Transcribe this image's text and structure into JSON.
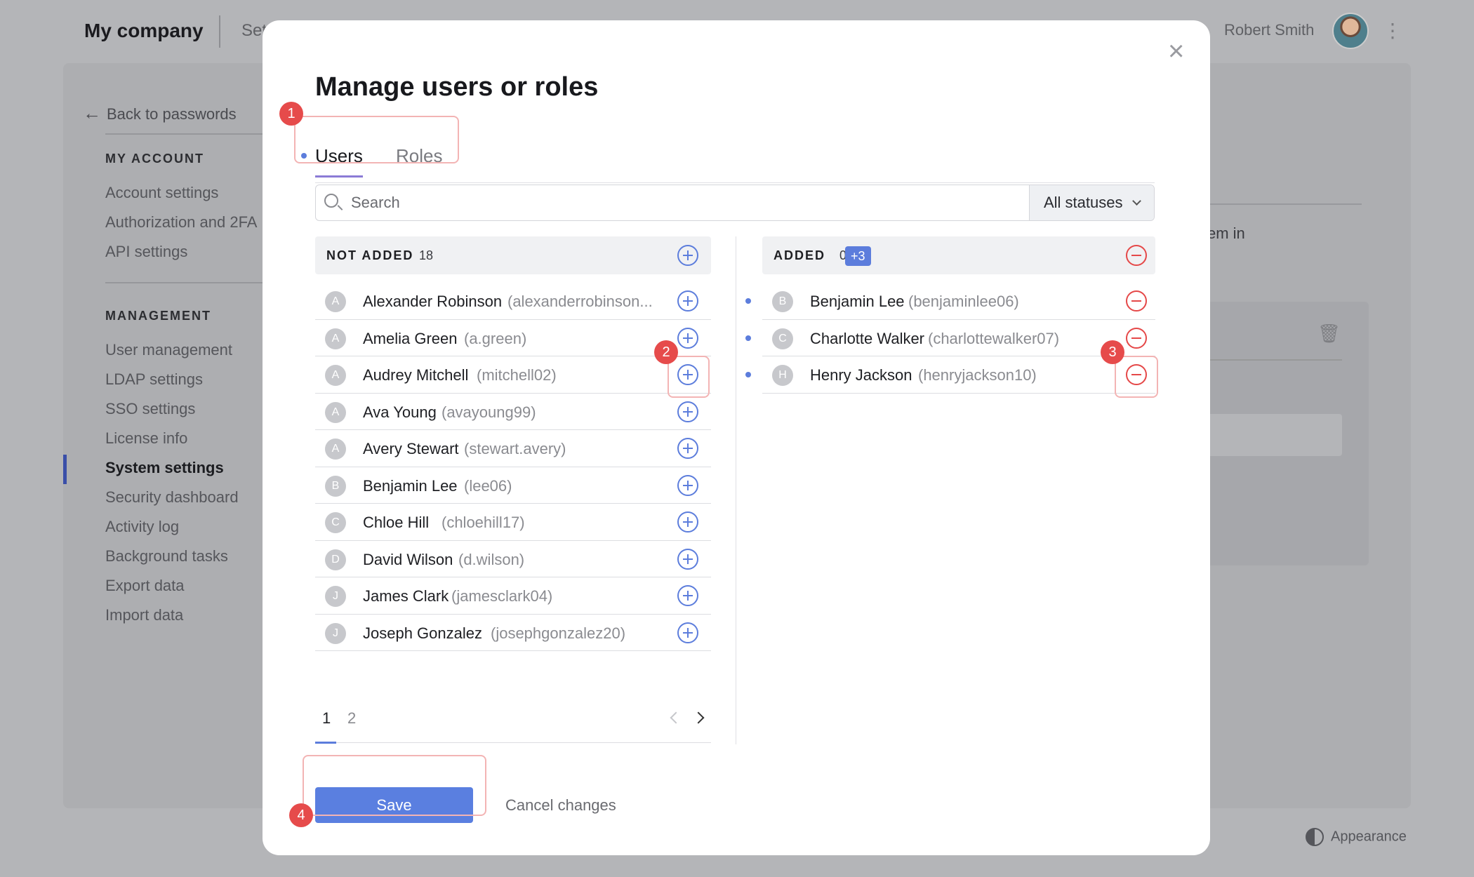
{
  "topbar": {
    "brand": "My company",
    "section": "Set",
    "user_name": "Robert Smith",
    "kebab": "⋮"
  },
  "sidebar": {
    "back_label": "Back to passwords",
    "my_account_heading": "MY ACCOUNT",
    "my_account_items": [
      "Account settings",
      "Authorization and 2FA",
      "API settings"
    ],
    "management_heading": "MANAGEMENT",
    "management_items": [
      {
        "label": "User management",
        "active": false
      },
      {
        "label": "LDAP settings",
        "active": false
      },
      {
        "label": "SSO settings",
        "active": false
      },
      {
        "label": "License info",
        "active": false
      },
      {
        "label": "System settings",
        "active": true
      },
      {
        "label": "Security dashboard",
        "active": false
      },
      {
        "label": "Activity log",
        "active": false
      },
      {
        "label": "Background tasks",
        "active": false
      },
      {
        "label": "Export data",
        "active": false
      },
      {
        "label": "Import data",
        "active": false
      }
    ]
  },
  "bg_right": {
    "partial_text": "em in"
  },
  "appearance_label": "Appearance",
  "modal": {
    "title": "Manage users or roles",
    "close_glyph": "×",
    "tabs": {
      "users": "Users",
      "roles": "Roles"
    },
    "search": {
      "placeholder": "Search"
    },
    "status_filter": "All statuses",
    "not_added": {
      "title": "NOT ADDED",
      "count": "18",
      "rows": [
        {
          "initial": "A",
          "name": "Alexander Robinson",
          "username": "(alexanderrobinson..."
        },
        {
          "initial": "A",
          "name": "Amelia Green",
          "username": "(a.green)"
        },
        {
          "initial": "A",
          "name": "Audrey Mitchell",
          "username": "(mitchell02)"
        },
        {
          "initial": "A",
          "name": "Ava Young",
          "username": "(avayoung99)"
        },
        {
          "initial": "A",
          "name": "Avery Stewart",
          "username": "(stewart.avery)"
        },
        {
          "initial": "B",
          "name": "Benjamin Lee",
          "username": "(lee06)"
        },
        {
          "initial": "C",
          "name": "Chloe Hill",
          "username": "(chloehill17)"
        },
        {
          "initial": "D",
          "name": "David Wilson",
          "username": "(d.wilson)"
        },
        {
          "initial": "J",
          "name": "James Clark",
          "username": "(jamesclark04)"
        },
        {
          "initial": "J",
          "name": "Joseph Gonzalez",
          "username": "(josephgonzalez20)"
        }
      ]
    },
    "added": {
      "title": "ADDED",
      "count": "0",
      "pending": "+3",
      "rows": [
        {
          "initial": "B",
          "name": "Benjamin Lee",
          "username": "(benjaminlee06)"
        },
        {
          "initial": "C",
          "name": "Charlotte Walker",
          "username": "(charlottewalker07)"
        },
        {
          "initial": "H",
          "name": "Henry Jackson",
          "username": "(henryjackson10)"
        }
      ]
    },
    "pagination": {
      "pages": [
        "1",
        "2"
      ],
      "current": "1"
    },
    "save_label": "Save",
    "cancel_label": "Cancel changes"
  },
  "callouts": [
    "1",
    "2",
    "3",
    "4"
  ],
  "colors": {
    "accent": "#5c7ddc",
    "remove": "#e54848",
    "callout": "#e64b4b"
  }
}
